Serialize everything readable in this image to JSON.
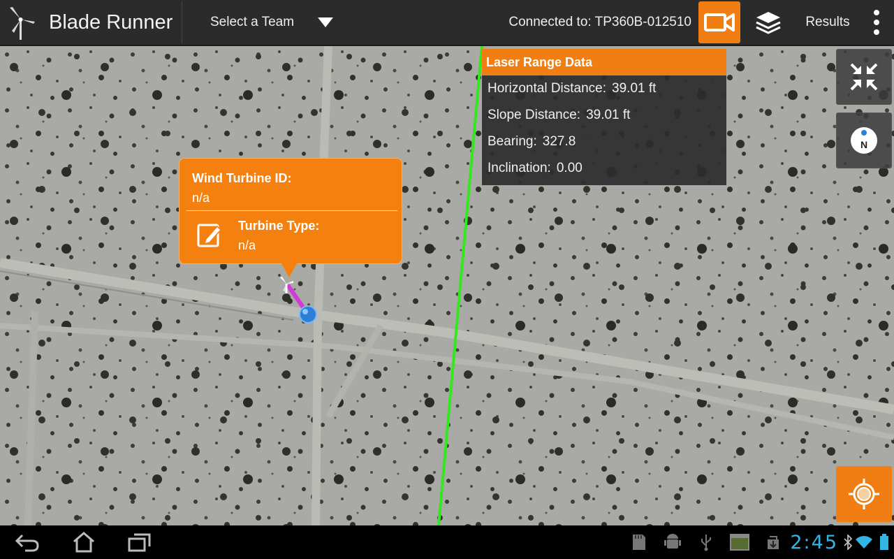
{
  "app": {
    "title": "Blade Runner"
  },
  "toolbar": {
    "team_select": "Select a Team",
    "connected": "Connected to: TP360B-012510",
    "results": "Results",
    "accent": "#f07e13"
  },
  "laser_panel": {
    "title": "Laser Range Data",
    "rows": [
      {
        "label": "Horizontal Distance:",
        "value": "39.01 ft"
      },
      {
        "label": "Slope Distance:",
        "value": "39.01 ft"
      },
      {
        "label": "Bearing:",
        "value": "327.8"
      },
      {
        "label": "Inclination:",
        "value": "0.00"
      }
    ]
  },
  "turbine_popup": {
    "id_label": "Wind Turbine ID:",
    "id_value": "n/a",
    "type_label": "Turbine Type:",
    "type_value": "n/a"
  },
  "map_controls": {
    "collapse": "collapse-icon",
    "compass": "compass-icon",
    "compass_letter": "N",
    "locate": "locate-icon"
  },
  "system_bar": {
    "clock": "2:45",
    "icons": [
      "back-icon",
      "home-icon",
      "recent-apps-icon",
      "sd-card-icon",
      "android-debug-icon",
      "usb-icon",
      "screenshot-icon",
      "download-icon",
      "bluetooth-icon",
      "wifi-icon",
      "battery-icon"
    ]
  }
}
